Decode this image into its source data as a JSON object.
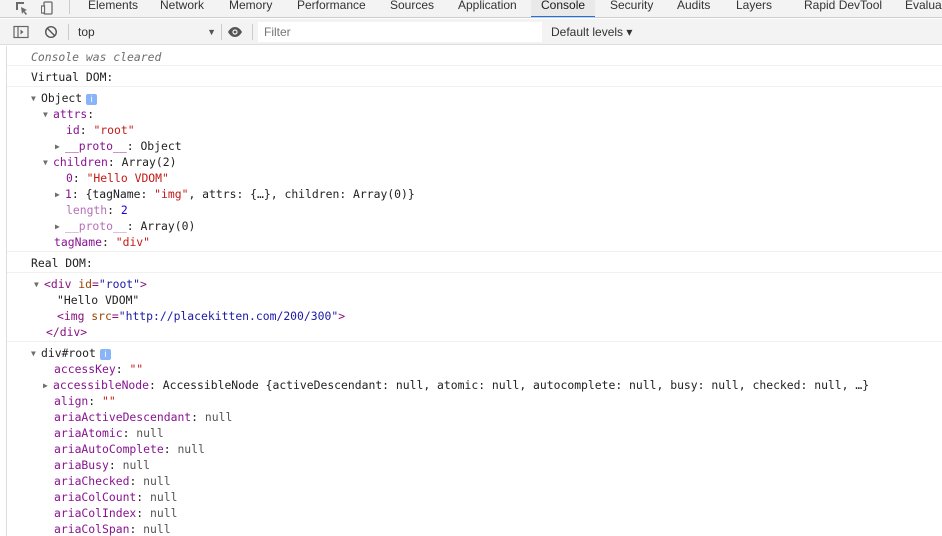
{
  "tabs": [
    "Elements",
    "Network",
    "Memory",
    "Performance",
    "Sources",
    "Application",
    "Console",
    "Security",
    "Audits",
    "Layers",
    "Rapid DevTool",
    "Evalua"
  ],
  "active_tab": "Console",
  "toolbar": {
    "context": "top",
    "filter_placeholder": "Filter",
    "levels": "Default levels ▾"
  },
  "console": {
    "cleared": "Console was cleared",
    "vdom_label": "Virtual DOM:",
    "object_label": "Object",
    "attrs_key": "attrs",
    "id_key": "id",
    "id_val": "\"root\"",
    "proto_key": "__proto__",
    "proto_obj": "Object",
    "children_key": "children",
    "children_val": "Array(2)",
    "child0_key": "0",
    "child0_val": "\"Hello VDOM\"",
    "child1_key": "1",
    "child1_pre": "{tagName: ",
    "child1_tag": "\"img\"",
    "child1_post": ", attrs: {…}, children: Array(0)}",
    "length_key": "length",
    "length_val": "2",
    "proto_arr": "Array(0)",
    "tagname_key": "tagName",
    "tagname_val": "\"div\"",
    "rdom_label": "Real DOM:",
    "div_open_tag": "div",
    "div_attr": "id",
    "div_attr_val": "\"root\"",
    "text_node": "\"Hello VDOM\"",
    "img_tag": "img",
    "img_attr": "src",
    "img_attr_val": "\"http://placekitten.com/200/300\"",
    "div_close": "</div>",
    "divroot_label": "div#root",
    "accesskey_key": "accessKey",
    "accesskey_val": "\"\"",
    "accnode_key": "accessibleNode",
    "accnode_val": "AccessibleNode {activeDescendant: null, atomic: null, autocomplete: null, busy: null, checked: null, …}",
    "align_key": "align",
    "align_val": "\"\"",
    "aria_props": [
      {
        "key": "ariaActiveDescendant",
        "val": "null"
      },
      {
        "key": "ariaAtomic",
        "val": "null"
      },
      {
        "key": "ariaAutoComplete",
        "val": "null"
      },
      {
        "key": "ariaBusy",
        "val": "null"
      },
      {
        "key": "ariaChecked",
        "val": "null"
      },
      {
        "key": "ariaColCount",
        "val": "null"
      },
      {
        "key": "ariaColIndex",
        "val": "null"
      },
      {
        "key": "ariaColSpan",
        "val": "null"
      }
    ]
  }
}
